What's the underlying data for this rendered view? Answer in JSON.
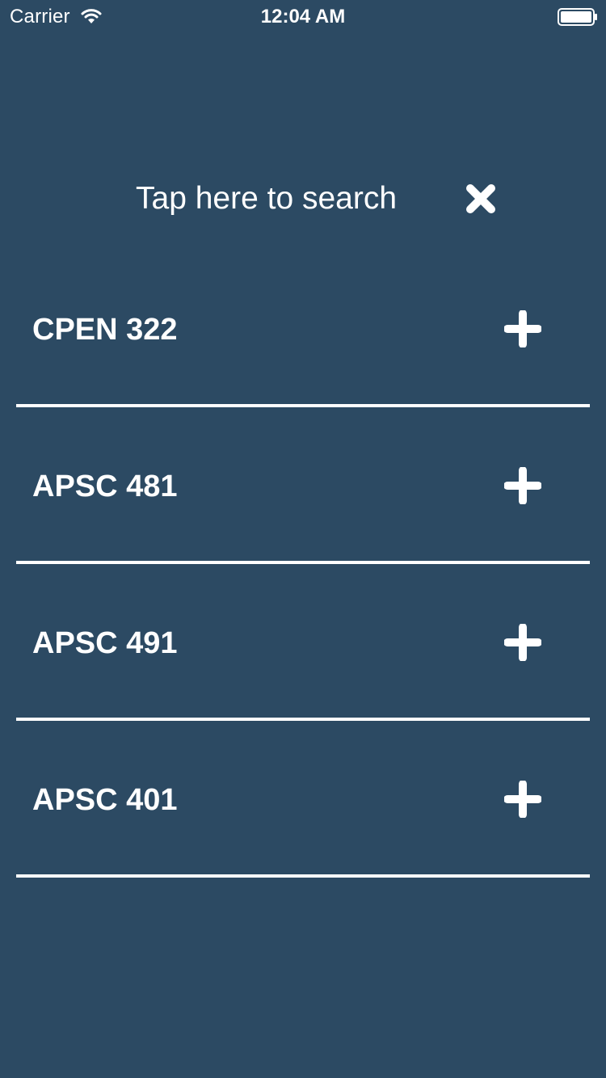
{
  "status_bar": {
    "carrier": "Carrier",
    "time": "12:04 AM",
    "wifi_icon": "wifi-icon",
    "battery_icon": "battery-icon"
  },
  "search": {
    "placeholder": "Tap here to search",
    "clear_icon": "close-icon"
  },
  "courses": [
    {
      "label": "CPEN 322",
      "action_icon": "plus-icon"
    },
    {
      "label": "APSC 481",
      "action_icon": "plus-icon"
    },
    {
      "label": "APSC 491",
      "action_icon": "plus-icon"
    },
    {
      "label": "APSC 401",
      "action_icon": "plus-icon"
    }
  ],
  "colors": {
    "background": "#2c4a63",
    "foreground": "#ffffff"
  }
}
